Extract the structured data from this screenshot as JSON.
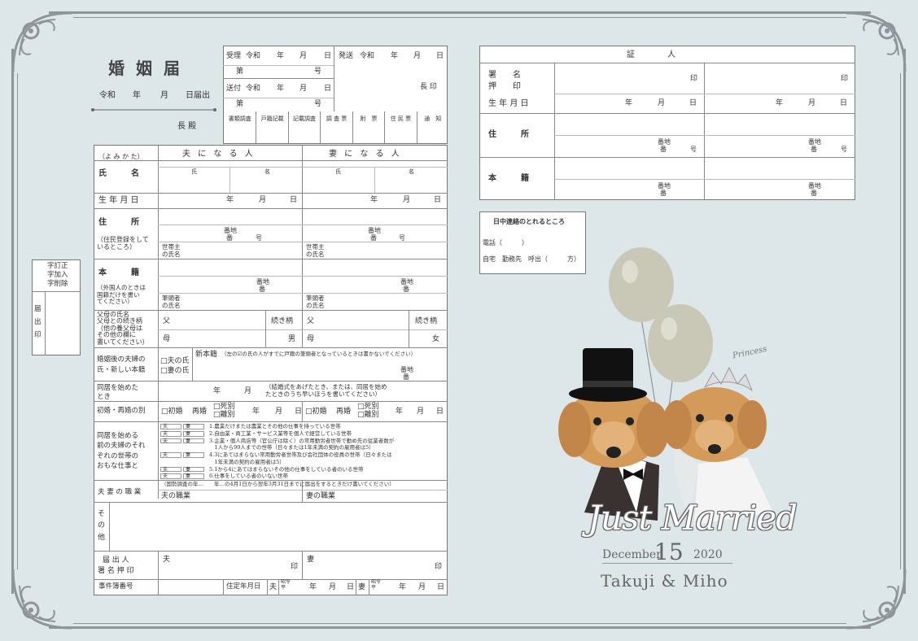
{
  "header": {
    "title": "婚姻届",
    "date_line": {
      "era": "令和",
      "year": "年",
      "month": "月",
      "filed": "日届出"
    },
    "addressee": "長 殿",
    "received": {
      "label": "受理",
      "era": "令和",
      "y": "年",
      "m": "月",
      "d": "日",
      "number_prefix": "第",
      "number_suffix": "号"
    },
    "sent": {
      "label": "送付",
      "era": "令和",
      "y": "年",
      "m": "月",
      "d": "日",
      "number_prefix": "第",
      "number_suffix": "号"
    },
    "issued": {
      "label": "発送",
      "era": "令和",
      "y": "年",
      "m": "月",
      "d": "日"
    },
    "chief_seal": "長 印",
    "office_boxes": [
      "書類調査",
      "戸籍記載",
      "記載調査",
      "調 査 票",
      "附　票",
      "住 民 票",
      "通　知"
    ]
  },
  "form": {
    "yomikata": "（よ み か た）",
    "husband_col": "夫 に な る 人",
    "wife_col": "妻 に な る 人",
    "name_label": "氏　　　名",
    "surname": "氏",
    "given": "名",
    "birth_label": "生 年 月 日",
    "ymd": {
      "y": "年",
      "m": "月",
      "d": "日"
    },
    "address_label": "住　　　所",
    "address_note": "（住民登録をして\nいるところ）",
    "banchi": "番地",
    "ban": "番",
    "go": "号",
    "householder": "世帯主\nの氏名",
    "honseki_label": "本　　　籍",
    "honseki_note": "（外国人のときは\n国籍だけを書い\nてください）",
    "koseki_head": "筆頭者\nの氏名",
    "parents_label": "父母の氏名\n父母との続き柄\n（他の養父母は\nその他の欄に\n書いてください）",
    "father": "父",
    "mother": "母",
    "relation": "続き柄",
    "son": "男",
    "daughter": "女",
    "new_name_label": "婚姻後の夫婦の\n氏・新しい本籍",
    "husband_name_opt": "□夫の氏",
    "wife_name_opt": "□妻の氏",
    "new_honseki": "新本籍",
    "new_honseki_note": "（左の☑の氏の人がすでに戸籍の筆頭者となっているときは書かないでください）",
    "cohabit_label": "同居を始めた\nとき",
    "cohabit_ym": {
      "y": "年",
      "m": "月"
    },
    "cohabit_note": "（結婚式をあげたとき、または、同居を始め\nたときのうち早いほうを書いてください）",
    "marriage_type_label": "初婚・再婚の別",
    "first": "□初婚",
    "re": "再婚",
    "death": "□死別",
    "divorce": "□離別",
    "household_label": "同居を始める\n前の夫婦のそれ\nぞれの世帯の\nおもな仕事と",
    "job_options": [
      "1.農業だけまたは農業とその他の仕事を持っている世帯",
      "2.自由業・商工業・サービス業等を個人で経営している世帯",
      "3.企業・個人商店等（官公庁は除く）の常用勤労者世帯で勤め先の従業者数が",
      "　1人から99人までの世帯（日々または1年未満の契約の雇用者は5）",
      "4.3にあてはまらない常用勤労者世帯及び会社団体の役員の世帯（日々または",
      "　1年未満の契約の雇用者は5）",
      "5.1から4にあてはまらないその他の仕事をしている者のいる世帯",
      "6.仕事をしている者のいない世帯"
    ],
    "job_husband": "夫",
    "job_wife": "妻",
    "occupation_label": "夫 妻 の 職 業",
    "census_note": "（国勢調査の年…　　年…の4月1日から翌年3月31日までに届出をするときだけ書いてください）",
    "husband_job": "夫の職業",
    "wife_job": "妻の職業",
    "other_label": "そ\nの\n他",
    "signature_label": "届 出 人\n署 名 押 印",
    "husband_sign": "夫",
    "wife_sign": "妻",
    "seal": "印",
    "office_number": "事件簿番号",
    "birthday_label": "住定年月日",
    "husband_short": "夫",
    "wife_short": "妻",
    "era_stack": "昭令\n平",
    "stamp_box": {
      "line1": "字訂正",
      "line2": "字加入",
      "line3": "字削除",
      "seal_label": "届\n出\n印"
    }
  },
  "witness": {
    "title": "証　　　　人",
    "name_label": "署　　名\n押　　印",
    "seal": "印",
    "birth_label": "生 年 月 日",
    "ymd": {
      "y": "年",
      "m": "月",
      "d": "日"
    },
    "address_label": "住　　　所",
    "honseki_label": "本　　　籍",
    "banchi": "番地",
    "ban": "番",
    "go": "号"
  },
  "contact": {
    "title": "日中連絡のとれるところ",
    "phone": "電話（　　　）",
    "options": "自宅　勤務先　呼出（　　　方）"
  },
  "decor": {
    "just_married": "Just Married",
    "month": "December",
    "day": "15",
    "year": "2020",
    "names": "Takuji & Miho",
    "princess": "Princess"
  },
  "colors": {
    "background": "#dde6e9",
    "frame": "#8e9499",
    "line": "#777777",
    "dog": "#d49a5a",
    "balloon": "#c9c8b7"
  }
}
